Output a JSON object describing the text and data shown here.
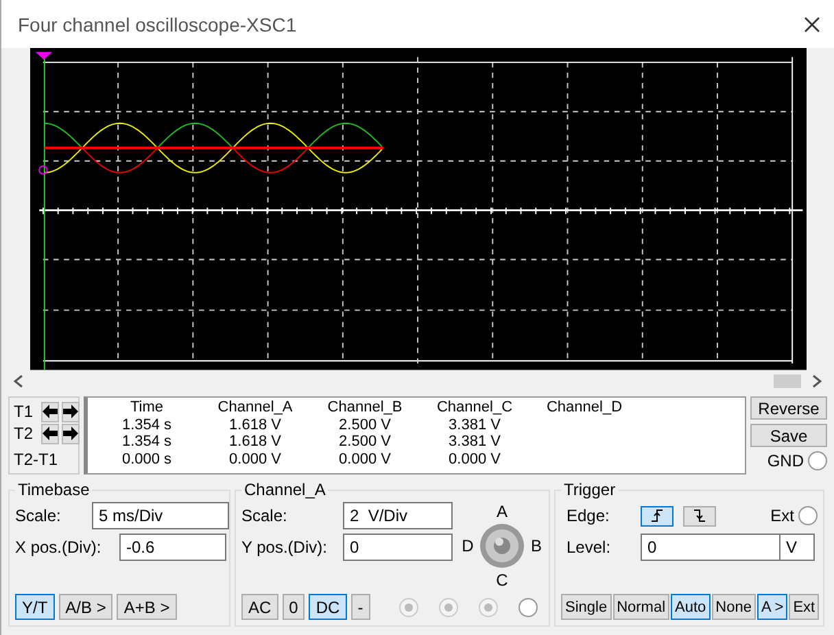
{
  "window": {
    "title": "Four channel oscilloscope-XSC1"
  },
  "cursors": [
    {
      "label": "T1"
    },
    {
      "label": "T2"
    }
  ],
  "difference_label": "T2-T1",
  "readout": {
    "columns": [
      "Time",
      "Channel_A",
      "Channel_B",
      "Channel_C",
      "Channel_D"
    ],
    "rows": [
      [
        "1.354 s",
        "1.618 V",
        "2.500 V",
        "3.381 V"
      ],
      [
        "1.354 s",
        "1.618 V",
        "2.500 V",
        "3.381 V"
      ],
      [
        "0.000 s",
        "0.000 V",
        "0.000 V",
        "0.000 V"
      ]
    ]
  },
  "side_buttons": [
    "Reverse",
    "Save"
  ],
  "gnd": {
    "label": "GND",
    "selected": false
  },
  "timebase": {
    "title": "Timebase",
    "scale_label": "Scale:",
    "scale": "5 ms/Div",
    "xpos_label": "X pos.(Div):",
    "xpos": "-0.6",
    "modes": [
      {
        "label": "Y/T",
        "selected": true
      },
      {
        "label": "A/B >",
        "selected": false
      },
      {
        "label": "A+B >",
        "selected": false
      }
    ]
  },
  "channel": {
    "title": "Channel_A",
    "scale_label": "Scale:",
    "scale": "2  V/Div",
    "ypos_label": "Y pos.(Div):",
    "ypos": "0",
    "couplings": [
      {
        "label": "AC",
        "selected": false
      },
      {
        "label": "0",
        "selected": false
      },
      {
        "label": "DC",
        "selected": true
      },
      {
        "label": "-",
        "selected": false
      }
    ],
    "knob_labels": {
      "top": "A",
      "right": "B",
      "bottom": "C",
      "left": "D"
    },
    "radios": [
      {
        "selected": true,
        "disabled": true
      },
      {
        "selected": true,
        "disabled": true
      },
      {
        "selected": true,
        "disabled": true
      },
      {
        "selected": false,
        "disabled": false
      }
    ]
  },
  "trigger": {
    "title": "Trigger",
    "edge_label": "Edge:",
    "edges": [
      {
        "kind": "rising",
        "selected": true
      },
      {
        "kind": "falling",
        "selected": false
      }
    ],
    "ext": {
      "label": "Ext",
      "selected": false
    },
    "level_label": "Level:",
    "level": "0",
    "unit": "V",
    "modes": [
      {
        "label": "Single",
        "selected": false
      },
      {
        "label": "Normal",
        "selected": false
      },
      {
        "label": "Auto",
        "selected": true
      },
      {
        "label": "None",
        "selected": false
      },
      {
        "label": "A >",
        "selected": true
      },
      {
        "label": "Ext",
        "selected": false
      }
    ]
  }
}
